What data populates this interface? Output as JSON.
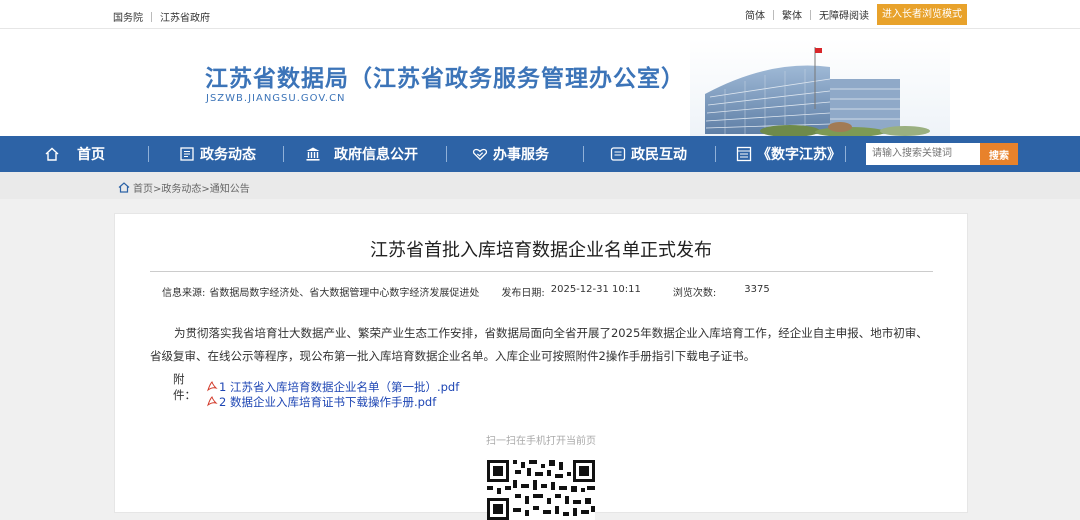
{
  "topbar": {
    "links_left": [
      "国务院",
      "江苏省政府"
    ],
    "links_right": [
      "简体",
      "繁体",
      "无障碍阅读"
    ],
    "elder_mode": "进入长者浏览模式"
  },
  "banner": {
    "title": "江苏省数据局（江苏省政务服务管理办公室）",
    "domain": "JSZWB.JIANGSU.GOV.CN"
  },
  "nav": {
    "items": [
      "首页",
      "政务动态",
      "政府信息公开",
      "办事服务",
      "政民互动",
      "《数字江苏》"
    ],
    "search_placeholder": "请输入搜索关键词",
    "search_button": "搜索"
  },
  "breadcrumb": "首页>政务动态>通知公告",
  "article": {
    "title": "江苏省首批入库培育数据企业名单正式发布",
    "source_label": "信息来源:",
    "source": "省数据局数字经济处、省大数据管理中心数字经济发展促进处",
    "date_label": "发布日期:",
    "date": "2025-12-31 10:11",
    "views_label": "浏览次数:",
    "views": "3375",
    "paragraph": "为贯彻落实我省培育壮大数据产业、繁荣产业生态工作安排，省数据局面向全省开展了2025年数据企业入库培育工作，经企业自主申报、地市初审、省级复审、在线公示等程序，现公布第一批入库培育数据企业名单。入库企业可按照附件2操作手册指引下载电子证书。",
    "attachments_label": "附件：",
    "attachments": [
      "1 江苏省入库培育数据企业名单（第一批）.pdf",
      "2 数据企业入库培育证书下载操作手册.pdf"
    ],
    "scan_text": "扫一扫在手机打开当前页"
  },
  "colors": {
    "brand_blue": "#2d63a6",
    "title_blue": "#3c74b8",
    "accent_orange": "#e8822b",
    "elder_orange": "#e8a22b",
    "link_blue": "#1e46b4"
  }
}
